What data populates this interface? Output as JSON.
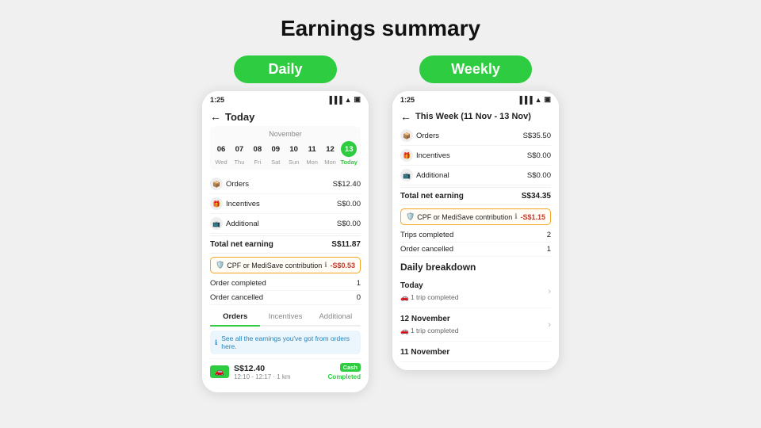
{
  "page": {
    "title": "Earnings summary"
  },
  "daily": {
    "tab_label": "Daily",
    "status_time": "1:25",
    "header": "Today",
    "calendar": {
      "month": "November",
      "days": [
        {
          "num": "06",
          "label": "Wed",
          "today": false
        },
        {
          "num": "07",
          "label": "Thu",
          "today": false
        },
        {
          "num": "08",
          "label": "Fri",
          "today": false
        },
        {
          "num": "09",
          "label": "Sat",
          "today": false
        },
        {
          "num": "10",
          "label": "Sun",
          "today": false
        },
        {
          "num": "11",
          "label": "Mon",
          "today": false
        },
        {
          "num": "12",
          "label": "Mon",
          "today": false
        },
        {
          "num": "13",
          "label": "Today",
          "today": true
        }
      ]
    },
    "earnings": [
      {
        "label": "Orders",
        "icon": "📦",
        "value": "S$12.40"
      },
      {
        "label": "Incentives",
        "icon": "🎁",
        "value": "S$0.00"
      },
      {
        "label": "Additional",
        "icon": "📺",
        "value": "S$0.00"
      }
    ],
    "total_label": "Total net earning",
    "total_value": "S$11.87",
    "cpf_label": "CPF or MediSave contribution",
    "cpf_value": "-S$0.53",
    "stats": [
      {
        "label": "Order completed",
        "value": "1"
      },
      {
        "label": "Order cancelled",
        "value": "0"
      }
    ],
    "tabs": [
      "Orders",
      "Incentives",
      "Additional"
    ],
    "active_tab": "Orders",
    "info_text": "See all the earnings you've got from orders here.",
    "order": {
      "amount": "S$12.40",
      "cash_label": "Cash",
      "time": "12:10 - 12:17 · 1 km",
      "status": "Completed"
    }
  },
  "weekly": {
    "tab_label": "Weekly",
    "status_time": "1:25",
    "header": "This Week (11 Nov - 13 Nov)",
    "earnings": [
      {
        "label": "Orders",
        "icon": "📦",
        "value": "S$35.50"
      },
      {
        "label": "Incentives",
        "icon": "🎁",
        "value": "S$0.00"
      },
      {
        "label": "Additional",
        "icon": "📺",
        "value": "S$0.00"
      }
    ],
    "total_label": "Total net earning",
    "total_value": "S$34.35",
    "cpf_label": "CPF or MediSave contribution",
    "cpf_value": "-S$1.15",
    "stats": [
      {
        "label": "Trips completed",
        "value": "2"
      },
      {
        "label": "Order cancelled",
        "value": "1"
      }
    ],
    "breakdown_title": "Daily breakdown",
    "breakdown_items": [
      {
        "date": "Today",
        "sub": "🚗 1 trip completed",
        "has_chevron": true
      },
      {
        "date": "12 November",
        "sub": "🚗 1 trip completed",
        "has_chevron": true
      },
      {
        "date": "11 November",
        "sub": "",
        "has_chevron": false
      }
    ]
  }
}
